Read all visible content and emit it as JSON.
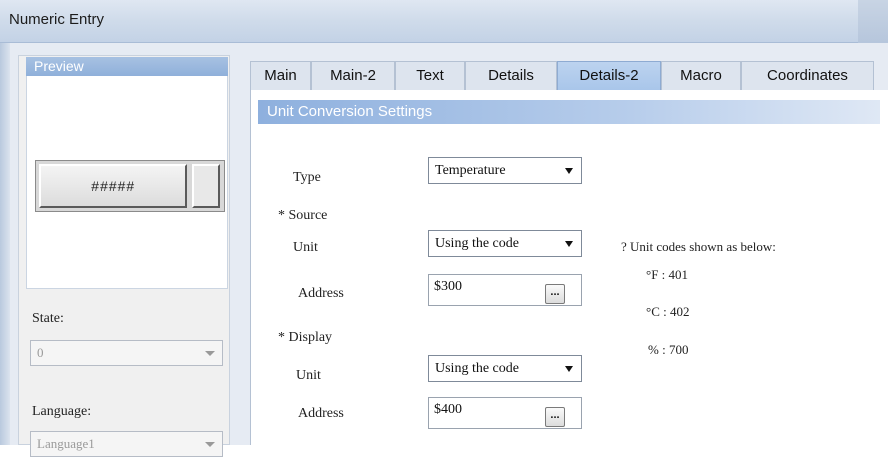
{
  "window": {
    "title": "Numeric Entry"
  },
  "left_panel": {
    "preview_label": "Preview",
    "preview_value": "#####",
    "state_label": "State:",
    "state_value": "0",
    "language_label": "Language:",
    "language_value": "Language1"
  },
  "tabs": [
    {
      "label": "Main"
    },
    {
      "label": "Main-2"
    },
    {
      "label": "Text"
    },
    {
      "label": "Details"
    },
    {
      "label": "Details-2",
      "active": true
    },
    {
      "label": "Macro"
    },
    {
      "label": "Coordinates"
    }
  ],
  "unit_conversion": {
    "header": "Unit Conversion Settings",
    "type_label": "Type",
    "type_value": "Temperature",
    "source_label": "* Source",
    "source_unit_label": "Unit",
    "source_unit_value": "Using the code",
    "source_address_label": "Address",
    "source_address_value": "$300",
    "display_label": "* Display",
    "display_unit_label": "Unit",
    "display_unit_value": "Using the code",
    "display_address_label": "Address",
    "display_address_value": "$400",
    "browse_label": "...",
    "codes_note": "? Unit codes shown as below:",
    "codes": [
      "°F : 401",
      "°C : 402",
      "% : 700"
    ]
  }
}
